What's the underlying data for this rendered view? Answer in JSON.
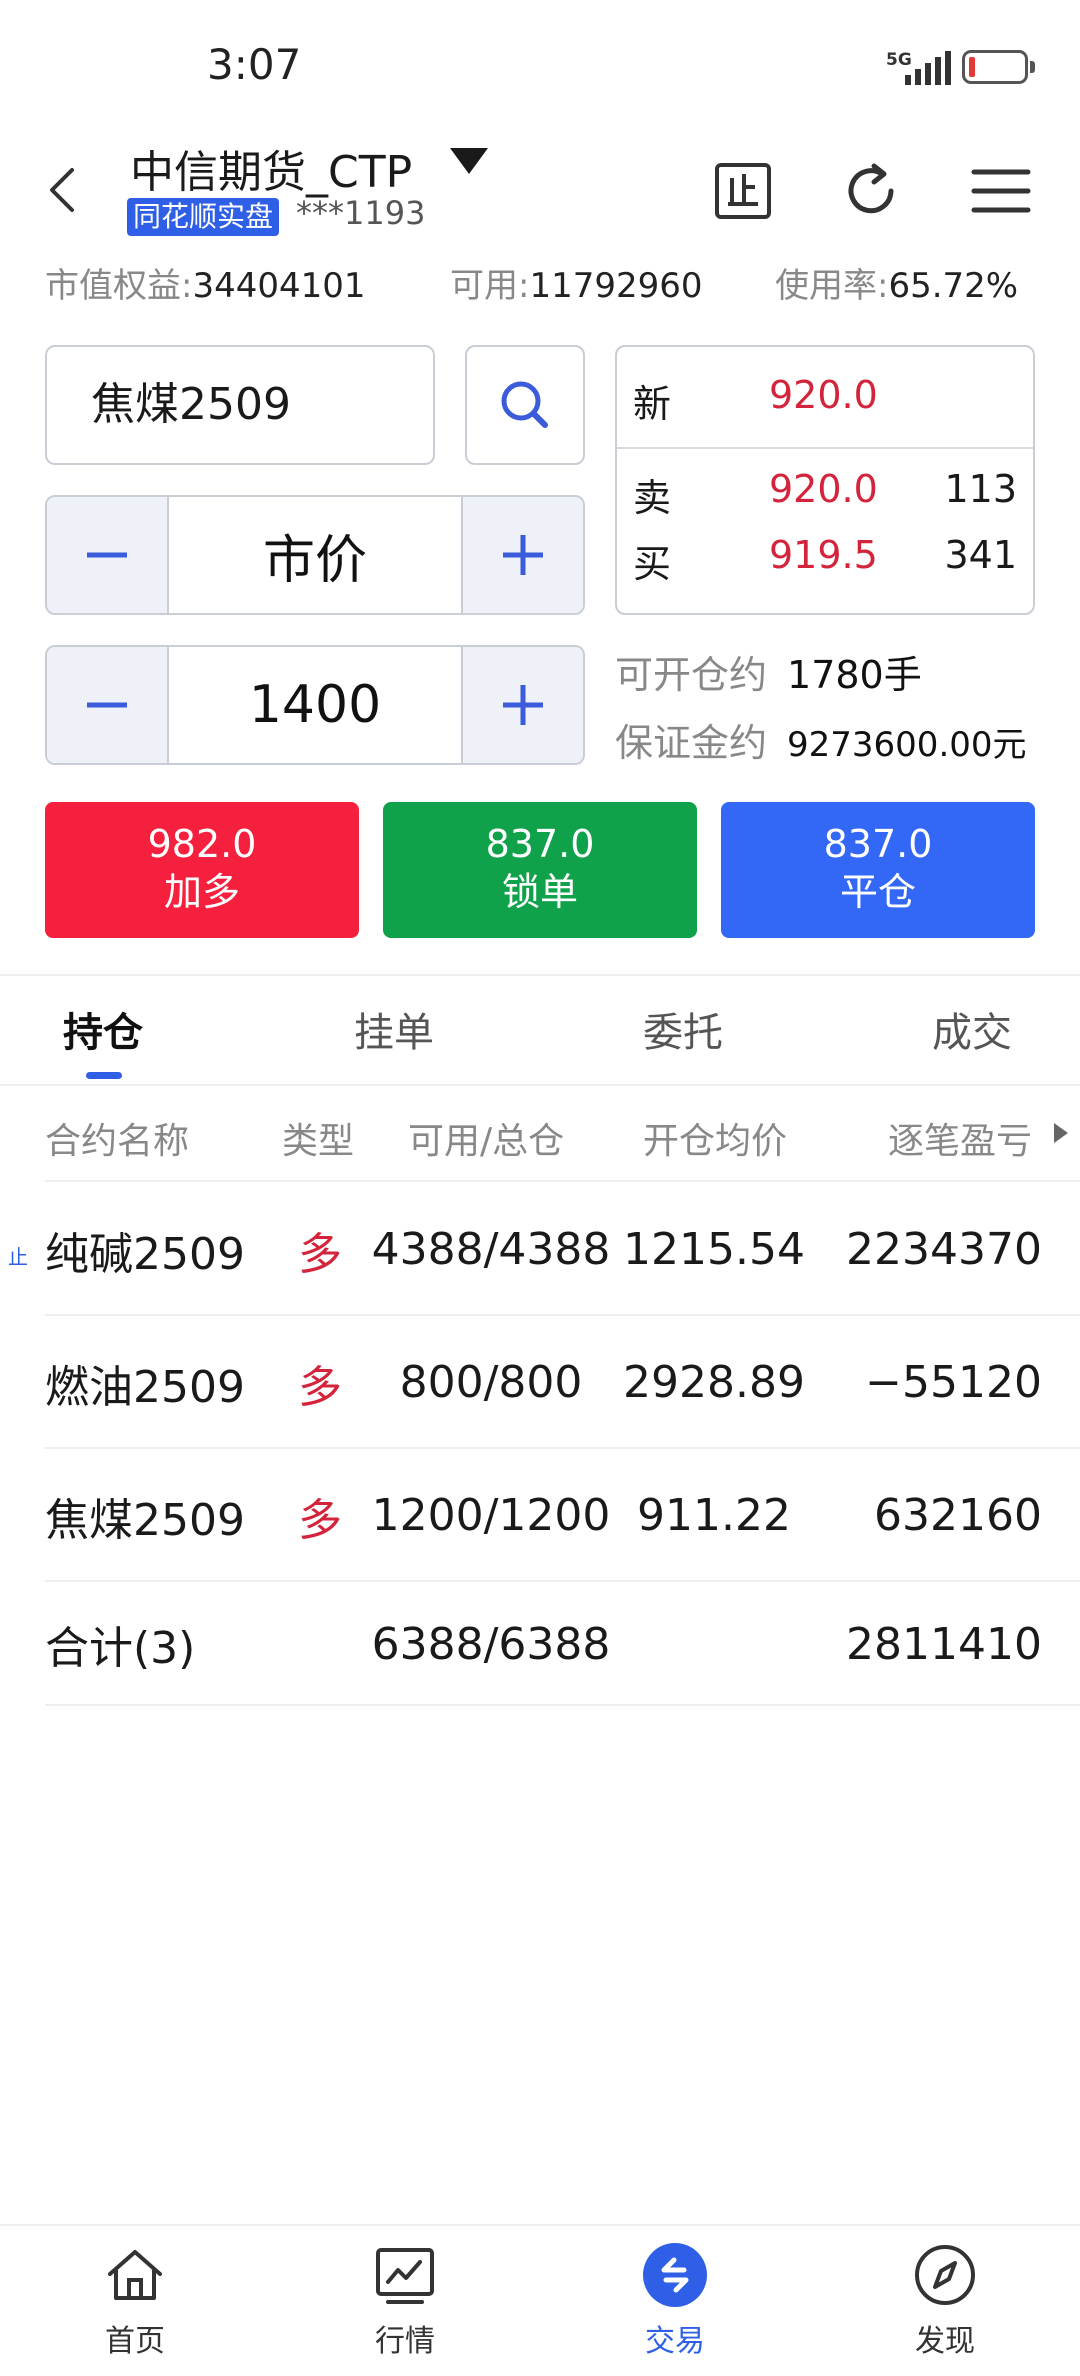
{
  "status": {
    "time": "3:07",
    "network": "5G"
  },
  "header": {
    "title": "中信期货_CTP",
    "badge": "同花顺实盘",
    "account": "***1193"
  },
  "summary": {
    "equity_label": "市值权益:",
    "equity_value": "34404101",
    "available_label": "可用:",
    "available_value": "11792960",
    "usage_label": "使用率:",
    "usage_value": "65.72%"
  },
  "order": {
    "contract": "焦煤2509",
    "price_mode": "市价",
    "quantity": "1400"
  },
  "quote": {
    "last_label": "新",
    "last_price": "920.0",
    "ask_label": "卖",
    "ask_price": "920.0",
    "ask_volume": "113",
    "bid_label": "买",
    "bid_price": "919.5",
    "bid_volume": "341"
  },
  "margin_info": {
    "open_label": "可开仓约",
    "open_value": "1780手",
    "margin_label": "保证金约",
    "margin_value": "9273600.00元"
  },
  "actions": [
    {
      "price": "982.0",
      "label": "加多",
      "color": "#f5203e"
    },
    {
      "price": "837.0",
      "label": "锁单",
      "color": "#0fa24a"
    },
    {
      "price": "837.0",
      "label": "平仓",
      "color": "#3367f5"
    }
  ],
  "tabs": [
    "持仓",
    "挂单",
    "委托",
    "成交"
  ],
  "table": {
    "headers": [
      "合约名称",
      "类型",
      "可用/总仓",
      "开仓均价",
      "逐笔盈亏"
    ],
    "rows": [
      {
        "tag": "止",
        "name": "纯碱2509",
        "type": "多",
        "position": "4388/4388",
        "avg_price": "1215.54",
        "pnl": "2234370"
      },
      {
        "tag": "",
        "name": "燃油2509",
        "type": "多",
        "position": "800/800",
        "avg_price": "2928.89",
        "pnl": "−55120"
      },
      {
        "tag": "",
        "name": "焦煤2509",
        "type": "多",
        "position": "1200/1200",
        "avg_price": "911.22",
        "pnl": "632160"
      }
    ],
    "total": {
      "name": "合计(3)",
      "position": "6388/6388",
      "pnl": "2811410"
    }
  },
  "nav": [
    {
      "label": "首页",
      "icon": "home-icon"
    },
    {
      "label": "行情",
      "icon": "chart-icon"
    },
    {
      "label": "交易",
      "icon": "trade-icon"
    },
    {
      "label": "发现",
      "icon": "compass-icon"
    }
  ],
  "colors": {
    "accent": "#2f5fe6",
    "profit": "#d4243b",
    "loss": "#17a254"
  }
}
